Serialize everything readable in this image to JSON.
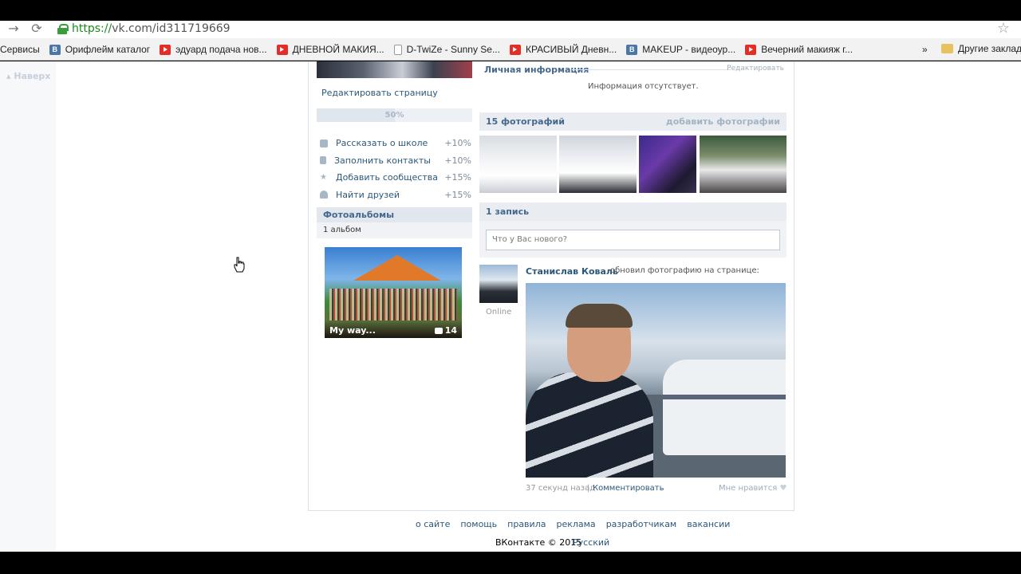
{
  "browser": {
    "url_scheme": "https://",
    "url_rest": "vk.com/id311719669",
    "bookmarks": [
      {
        "label": "Сервисы",
        "icon": "apps-icon"
      },
      {
        "label": "Орифлейм каталог",
        "icon": "vk-icon"
      },
      {
        "label": "эдуард подача нов...",
        "icon": "youtube-icon"
      },
      {
        "label": "ДНЕВНОЙ МАКИЯ...",
        "icon": "youtube-icon"
      },
      {
        "label": "D-TwiZe - Sunny Se...",
        "icon": "page-icon"
      },
      {
        "label": "КРАСИВЫЙ Дневн...",
        "icon": "youtube-icon"
      },
      {
        "label": "MAKEUP - видеоур...",
        "icon": "vk-icon"
      },
      {
        "label": "Вечерний макияж г...",
        "icon": "youtube-icon"
      }
    ],
    "more": "»",
    "other_bookmarks": "Другие заклад"
  },
  "left_nav": {
    "up": "Наверх"
  },
  "profile": {
    "edit_page": "Редактировать страницу",
    "progress": {
      "label": "50%",
      "value": 0.5
    },
    "tasks": [
      {
        "label": "Рассказать о школе",
        "value": "+10%",
        "icon": "school-icon"
      },
      {
        "label": "Заполнить контакты",
        "value": "+10%",
        "icon": "phone-icon"
      },
      {
        "label": "Добавить сообщества",
        "value": "+15%",
        "icon": "star-icon"
      },
      {
        "label": "Найти друзей",
        "value": "+15%",
        "icon": "friends-icon"
      }
    ],
    "albums": {
      "title": "Фотоальбомы",
      "count": "1 альбом",
      "album_title": "My way...",
      "album_photos": "14"
    },
    "personal": {
      "title": "Личная информация",
      "edit": "Редактировать",
      "empty": "Информация отсутствует."
    },
    "photos": {
      "title": "15 фотографий",
      "add": "добавить фотографии"
    },
    "wall": {
      "title": "1 запись",
      "placeholder": "Что у Вас нового?",
      "post": {
        "author": "Станислав Коваль",
        "action": "обновил фотографию на странице:",
        "online": "Online",
        "time": "37 секунд назад",
        "separator": "|",
        "comment": "Комментировать",
        "like": "Мне нравится"
      }
    }
  },
  "footer": {
    "links": [
      "о сайте",
      "помощь",
      "правила",
      "реклама",
      "разработчикам",
      "вакансии"
    ],
    "copyright": "ВКонтакте © 2015",
    "language": "Русский"
  }
}
